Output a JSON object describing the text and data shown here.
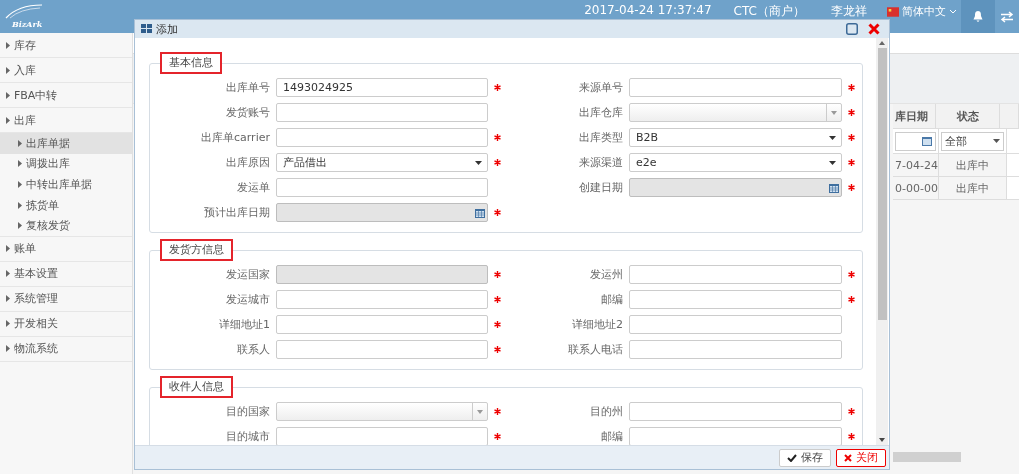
{
  "header": {
    "logo": "BizArk",
    "datetime": "2017-04-24 17:37:47",
    "account": "CTC（商户）",
    "user": "李龙祥",
    "language": "简体中文"
  },
  "sidebar": {
    "items": [
      {
        "label": "库存",
        "selected": false
      },
      {
        "label": "入库",
        "selected": false
      },
      {
        "label": "FBA中转",
        "selected": false
      },
      {
        "label": "出库",
        "selected": false,
        "expanded": true,
        "children": [
          {
            "label": "出库单据",
            "selected": true
          },
          {
            "label": "调拨出库",
            "selected": false
          },
          {
            "label": "中转出库单据",
            "selected": false
          },
          {
            "label": "拣货单",
            "selected": false
          },
          {
            "label": "复核发货",
            "selected": false
          }
        ]
      },
      {
        "label": "账单",
        "selected": false
      },
      {
        "label": "基本设置",
        "selected": false
      },
      {
        "label": "系统管理",
        "selected": false
      },
      {
        "label": "开发相关",
        "selected": false
      },
      {
        "label": "物流系统",
        "selected": false
      }
    ]
  },
  "grid": {
    "columns": [
      "库日期",
      "状态"
    ],
    "filters": [
      {
        "kind": "date"
      },
      {
        "kind": "select",
        "value": "全部"
      }
    ],
    "rows": [
      [
        "7-04-24",
        "出库中"
      ],
      [
        "0-00-00",
        "出库中"
      ]
    ]
  },
  "dialog": {
    "title": "添加",
    "sections": [
      {
        "title": "基本信息",
        "highlighted": true,
        "fields": [
          {
            "label": "出库单号",
            "kind": "text",
            "value": "1493024925",
            "required": true,
            "disabled": false
          },
          {
            "label": "来源单号",
            "kind": "text",
            "required": true,
            "disabled": false
          },
          {
            "label": "发货账号",
            "kind": "text",
            "required": false,
            "disabled": false
          },
          {
            "label": "出库仓库",
            "kind": "combo",
            "required": true,
            "disabled": false
          },
          {
            "label": "出库单carrier",
            "kind": "text",
            "required": true,
            "disabled": false
          },
          {
            "label": "出库类型",
            "kind": "select",
            "value": "B2B",
            "required": true,
            "disabled": false
          },
          {
            "label": "出库原因",
            "kind": "select",
            "value": "产品借出",
            "required": true,
            "disabled": false
          },
          {
            "label": "来源渠道",
            "kind": "select",
            "value": "e2e",
            "required": true,
            "disabled": false
          },
          {
            "label": "发运单",
            "kind": "text",
            "required": false,
            "disabled": false
          },
          {
            "label": "创建日期",
            "kind": "date",
            "required": true,
            "disabled": true
          },
          {
            "label": "预计出库日期",
            "kind": "date",
            "required": true,
            "disabled": true
          }
        ]
      },
      {
        "title": "发货方信息",
        "highlighted": true,
        "fields": [
          {
            "label": "发运国家",
            "kind": "text",
            "required": true,
            "disabled": true
          },
          {
            "label": "发运州",
            "kind": "text",
            "required": true,
            "disabled": false
          },
          {
            "label": "发运城市",
            "kind": "text",
            "required": true,
            "disabled": false
          },
          {
            "label": "邮编",
            "kind": "text",
            "required": true,
            "disabled": false
          },
          {
            "label": "详细地址1",
            "kind": "text",
            "required": true,
            "disabled": false
          },
          {
            "label": "详细地址2",
            "kind": "text",
            "required": false,
            "disabled": false
          },
          {
            "label": "联系人",
            "kind": "text",
            "required": true,
            "disabled": false
          },
          {
            "label": "联系人电话",
            "kind": "text",
            "required": false,
            "disabled": false
          }
        ]
      },
      {
        "title": "收件人信息",
        "highlighted": true,
        "fields": [
          {
            "label": "目的国家",
            "kind": "combo",
            "required": true,
            "disabled": false
          },
          {
            "label": "目的州",
            "kind": "text",
            "required": true,
            "disabled": false
          },
          {
            "label": "目的城市",
            "kind": "text",
            "required": true,
            "disabled": false
          },
          {
            "label": "邮编",
            "kind": "text",
            "required": true,
            "disabled": false
          }
        ]
      }
    ],
    "buttons": [
      {
        "label": "保存",
        "kind": "save"
      },
      {
        "label": "关闭",
        "kind": "close"
      }
    ]
  }
}
